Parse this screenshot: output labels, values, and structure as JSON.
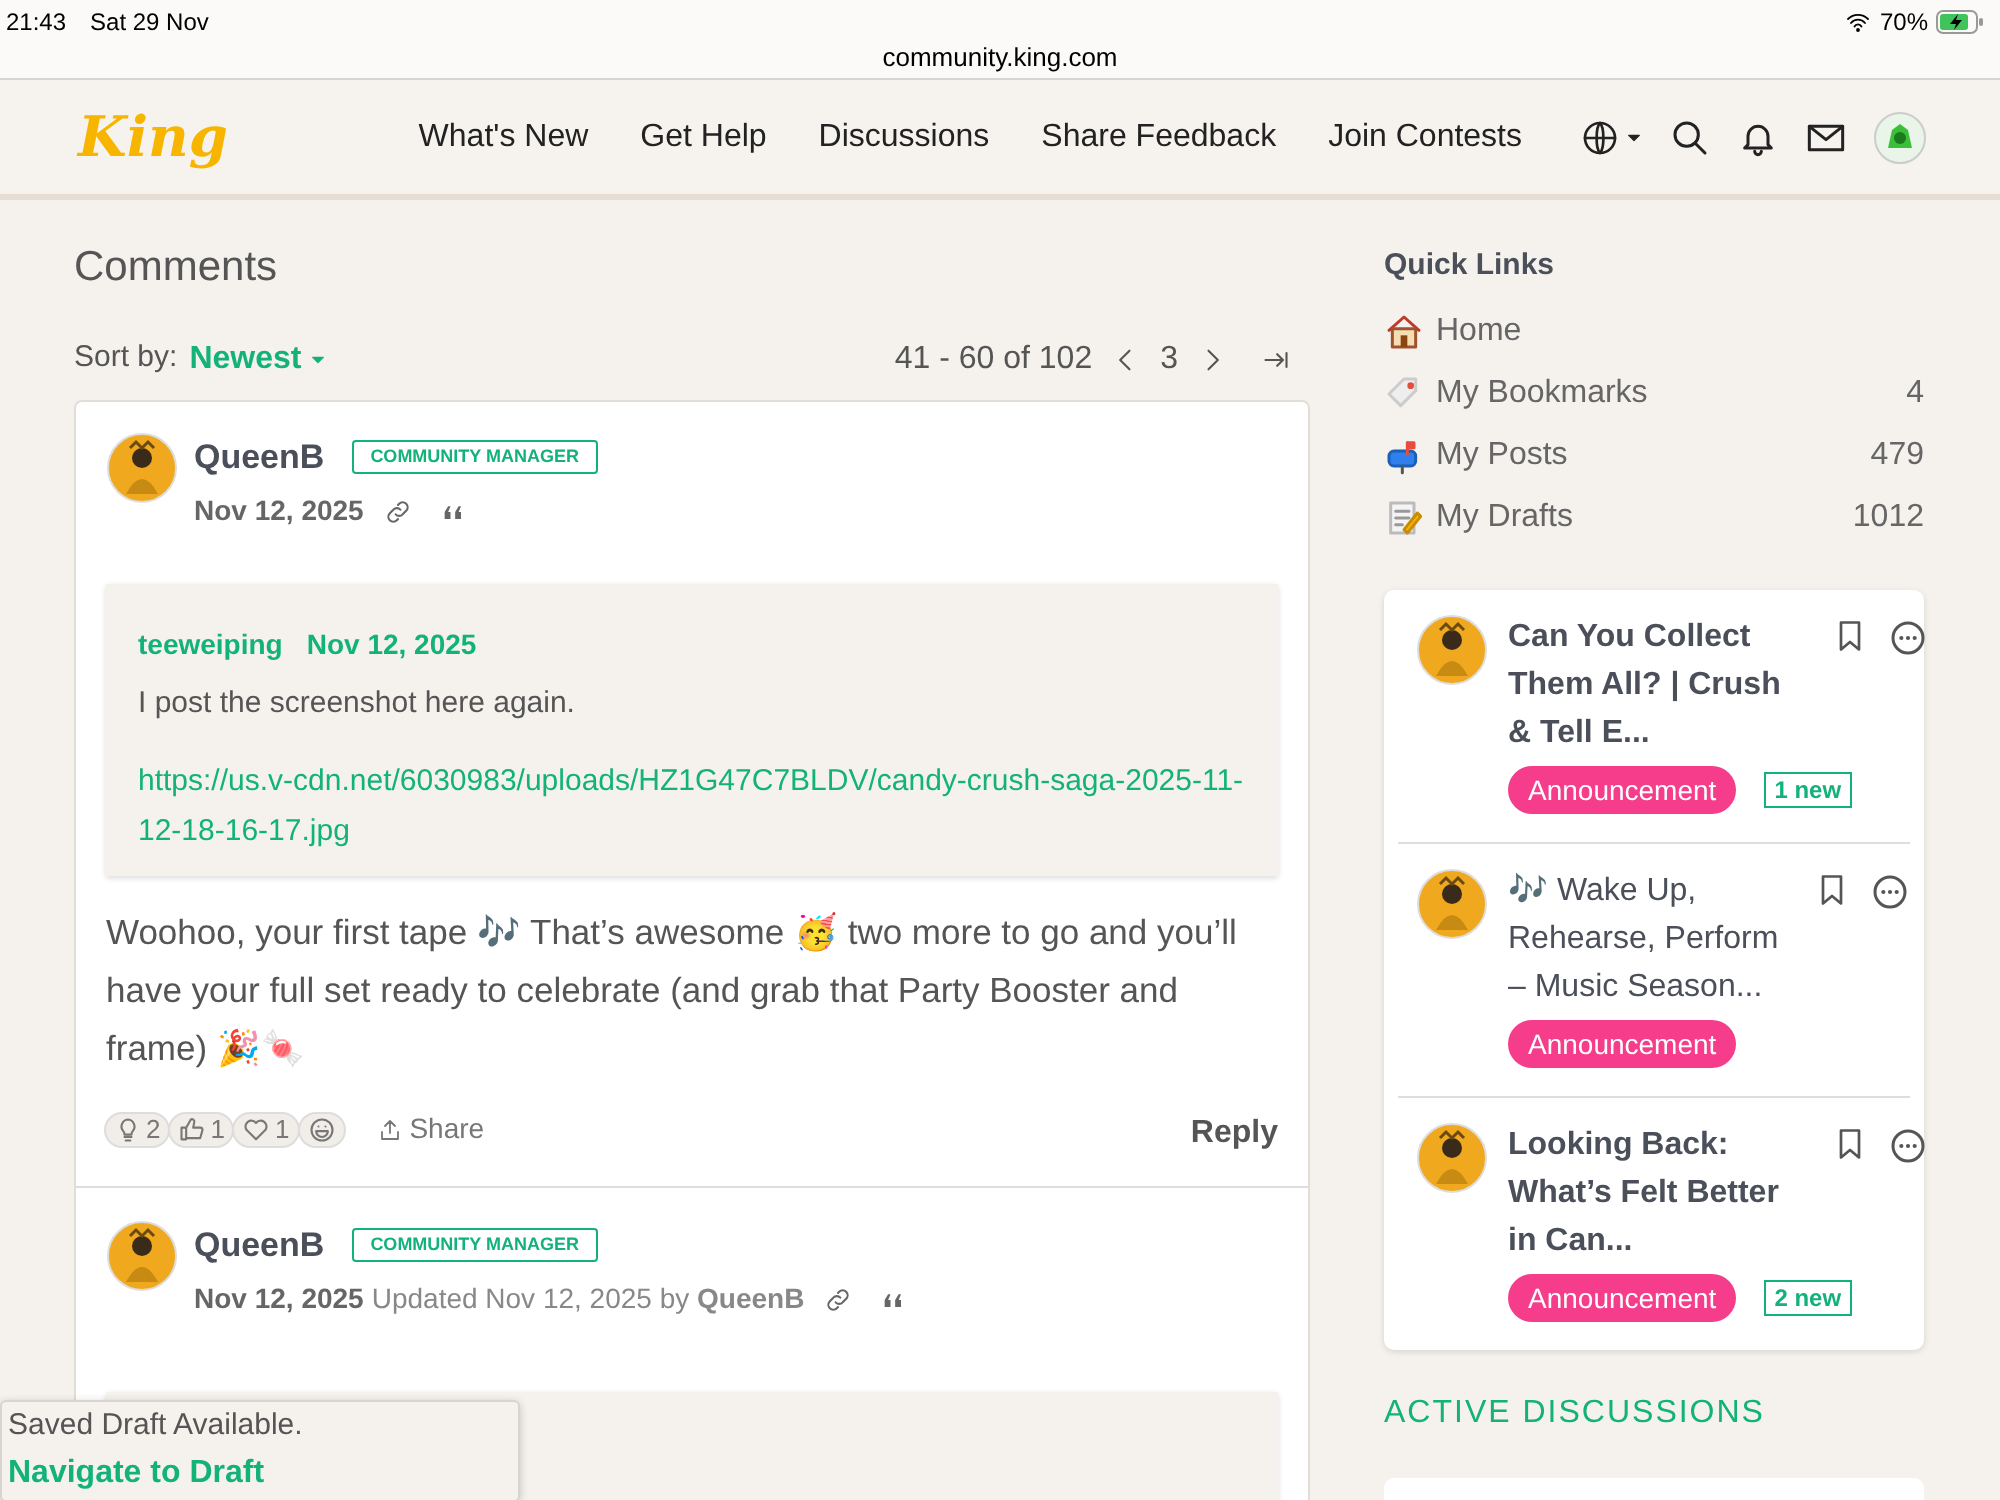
{
  "status_bar": {
    "time": "21:43",
    "date": "Sat 29 Nov",
    "battery": "70%",
    "url": "community.king.com"
  },
  "header": {
    "logo": "King",
    "nav": [
      "What's New",
      "Get Help",
      "Discussions",
      "Share Feedback",
      "Join Contests"
    ]
  },
  "comments_section": {
    "title": "Comments",
    "sort_label": "Sort by:",
    "sort_value": "Newest",
    "range": "41 - 60 of 102",
    "page": "3"
  },
  "comments": [
    {
      "author": "QueenB",
      "badge": "COMMUNITY MANAGER",
      "date": "Nov 12, 2025",
      "quote": {
        "author": "teeweiping",
        "date": "Nov 12, 2025",
        "text": "I post the screenshot here again.",
        "link": "https://us.v-cdn.net/6030983/uploads/HZ1G47C7BLDV/candy-crush-saga-2025-11-12-18-16-17.jpg"
      },
      "body": "Woohoo, your first tape 🎶 That’s awesome 🥳 two more to go and you’ll have your full set ready to celebrate (and grab that Party Booster and frame) 🎉🍬",
      "reactions": [
        {
          "kind": "insightful",
          "count": "2"
        },
        {
          "kind": "like",
          "count": "1"
        },
        {
          "kind": "love",
          "count": "1"
        },
        {
          "kind": "laugh"
        }
      ],
      "share": "Share",
      "reply": "Reply"
    },
    {
      "author": "QueenB",
      "badge": "COMMUNITY MANAGER",
      "date": "Nov 12, 2025",
      "updated": "Updated Nov 12, 2025 by **QueenB**",
      "quote_box": true
    }
  ],
  "draft_toast": {
    "text": "Saved Draft Available.",
    "link": "Navigate to Draft"
  },
  "quick_links": {
    "title": "Quick Links",
    "items": [
      {
        "kind": "home",
        "label": "Home"
      },
      {
        "kind": "bookmarks",
        "label": "My Bookmarks",
        "count": "4"
      },
      {
        "kind": "posts",
        "label": "My Posts",
        "count": "479"
      },
      {
        "kind": "drafts",
        "label": "My Drafts",
        "count": "1012"
      }
    ]
  },
  "announcements": [
    {
      "title": "Can You Collect Them All? | Crush & Tell E...",
      "unread": true,
      "tag": "Announcement",
      "new": "1 new"
    },
    {
      "title": "🎶 Wake Up, Rehearse, Perform – Music Season...",
      "unread": false,
      "tag": "Announcement"
    },
    {
      "title": "Looking Back: What’s Felt Better in Can...",
      "unread": true,
      "tag": "Announcement",
      "new": "2 new"
    }
  ],
  "active_discussions": {
    "title": "ACTIVE DISCUSSIONS"
  }
}
